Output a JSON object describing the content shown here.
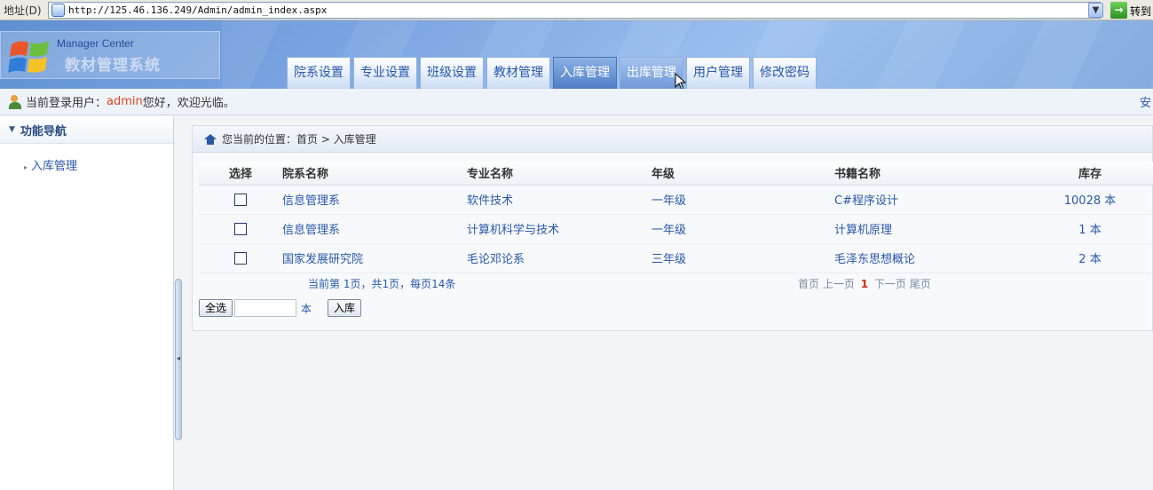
{
  "address_bar": {
    "label": "地址(D)",
    "url": "http://125.46.136.249/Admin/admin_index.aspx",
    "go_label": "转到"
  },
  "header": {
    "logo_caption": "Manager Center",
    "system_name": "教材管理系统",
    "tabs": [
      {
        "label": "院系设置"
      },
      {
        "label": "专业设置"
      },
      {
        "label": "班级设置"
      },
      {
        "label": "教材管理"
      },
      {
        "label": "入库管理",
        "state": "active"
      },
      {
        "label": "出库管理",
        "state": "hover"
      },
      {
        "label": "用户管理"
      },
      {
        "label": "修改密码"
      }
    ]
  },
  "userbar": {
    "prefix": "当前登录用户：",
    "username": "admin",
    "greeting": "您好，欢迎光临。",
    "right_text": "安"
  },
  "sidebar": {
    "heading": "功能导航",
    "items": [
      {
        "label": "入库管理"
      }
    ]
  },
  "breadcrumb": {
    "text": "您当前的位置：首页 > 入库管理"
  },
  "table": {
    "headers": [
      "选择",
      "院系名称",
      "专业名称",
      "年级",
      "书籍名称",
      "库存"
    ],
    "rows": [
      {
        "dept": "信息管理系",
        "major": "软件技术",
        "grade": "一年级",
        "book": "C#程序设计",
        "stock": "10028 本"
      },
      {
        "dept": "信息管理系",
        "major": "计算机科学与技术",
        "grade": "一年级",
        "book": "计算机原理",
        "stock": "1 本"
      },
      {
        "dept": "国家发展研究院",
        "major": "毛论邓论系",
        "grade": "三年级",
        "book": "毛泽东思想概论",
        "stock": "2 本"
      }
    ]
  },
  "pager": {
    "info": "当前第  1页，共1页，每页14条",
    "first": "首页",
    "prev": "上一页",
    "current": "1",
    "next": "下一页",
    "last": "尾页"
  },
  "actions": {
    "select_all": "全选",
    "quantity_value": "",
    "unit": "本",
    "stock_in": "入库"
  },
  "colors": {
    "accent": "#2a58a8",
    "username": "#e0451f",
    "active_tab": "#4f7fc6"
  }
}
